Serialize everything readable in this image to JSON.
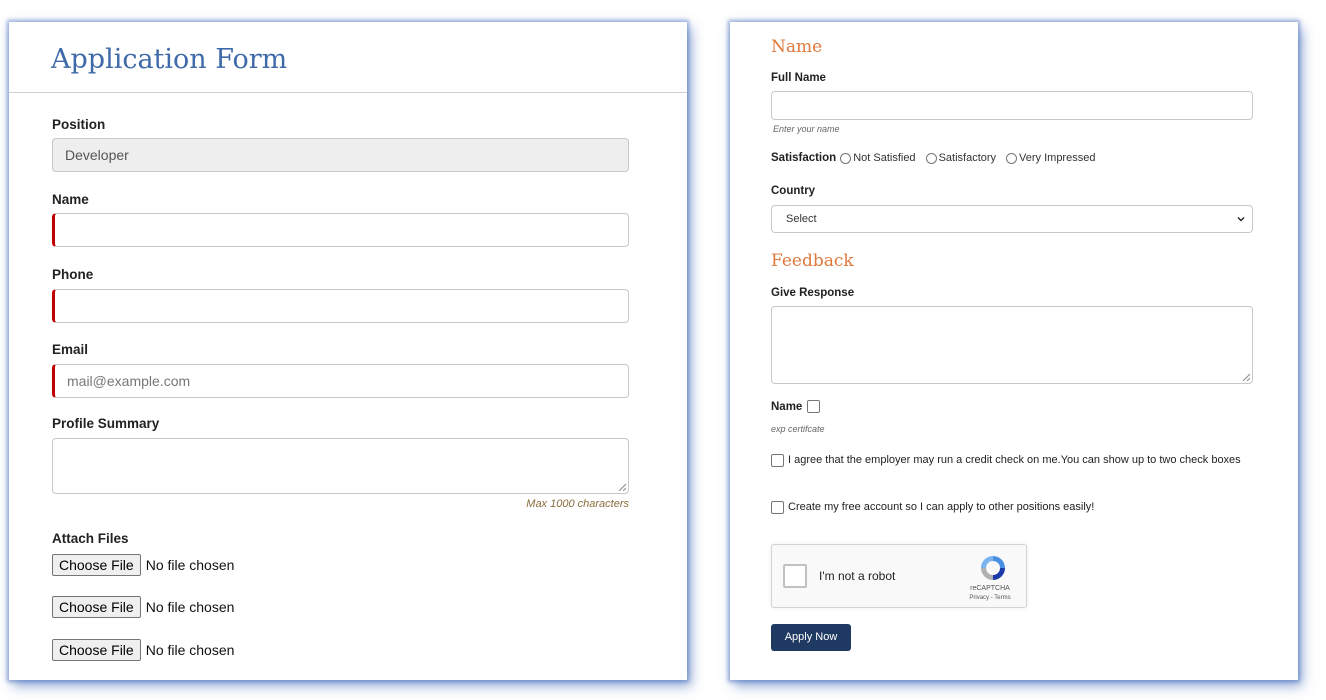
{
  "application_form": {
    "title": "Application Form",
    "position": {
      "label": "Position",
      "value": "Developer"
    },
    "name": {
      "label": "Name",
      "value": ""
    },
    "phone": {
      "label": "Phone",
      "value": ""
    },
    "email": {
      "label": "Email",
      "placeholder": "mail@example.com"
    },
    "profile_summary": {
      "label": "Profile Summary",
      "hint": "Max 1000 characters"
    },
    "attach_files": {
      "label": "Attach Files",
      "rows": [
        {
          "button": "Choose File",
          "status": "No file chosen"
        },
        {
          "button": "Choose File",
          "status": "No file chosen"
        },
        {
          "button": "Choose File",
          "status": "No file chosen"
        }
      ]
    }
  },
  "feedback_form": {
    "name_section": {
      "title": "Name",
      "full_name": {
        "label": "Full Name",
        "hint": "Enter your name"
      },
      "satisfaction": {
        "label": "Satisfaction",
        "options": [
          "Not Satisfied",
          "Satisfactory",
          "Very Impressed"
        ]
      },
      "country": {
        "label": "Country",
        "selected": "Select"
      }
    },
    "feedback_section": {
      "title": "Feedback",
      "give_response": {
        "label": "Give Response"
      },
      "name_check": {
        "label": "Name",
        "hint": "exp certifcate"
      },
      "agreements": [
        "I agree that the employer may run a credit check on me.You can show up to two check boxes",
        "Create my free account so I can apply to other positions easily!"
      ]
    },
    "captcha": {
      "label": "I'm not a robot",
      "brand": "reCAPTCHA",
      "links": "Privacy - Terms"
    },
    "apply_button": "Apply Now"
  },
  "colors": {
    "title_blue": "#3f6aa9",
    "section_orange": "#e0783c",
    "required_red": "#c00000",
    "apply_navy": "#1f3a62"
  }
}
